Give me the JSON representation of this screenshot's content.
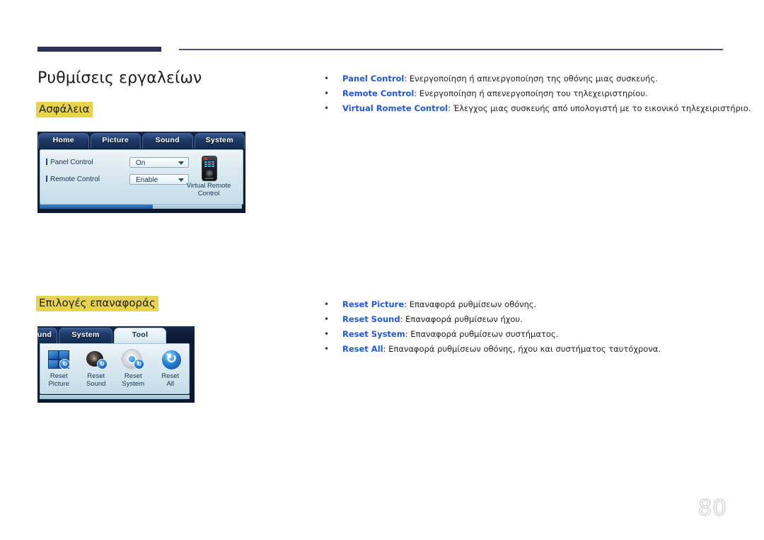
{
  "document": {
    "title": "Ρυθμίσεις εργαλείων",
    "page_number": "80",
    "accent_color": "#2e3156",
    "highlight_color": "#e8d34c",
    "term_color": "#2158d8"
  },
  "sections": [
    {
      "heading": "Ασφάλεια",
      "bullets": [
        {
          "bullet": "•",
          "term": "Panel Control",
          "sep": ": ",
          "desc": "Ενεργοποίηση ή απενεργοποίηση της οθόνης μιας συσκευής."
        },
        {
          "bullet": "•",
          "term": "Remote Control",
          "sep": ": ",
          "desc": "Ενεργοποίηση ή απενεργοποίηση του τηλεχειριστηρίου."
        },
        {
          "bullet": "•",
          "term": "Virtual Romete Control",
          "sep": ": ",
          "desc": "Έλεγχος μιας συσκευής από υπολογιστή με το εικονικό τηλεχειριστήριο."
        }
      ]
    },
    {
      "heading": "Επιλογές επαναφοράς",
      "bullets": [
        {
          "bullet": "•",
          "term": "Reset Picture",
          "sep": ": ",
          "desc": "Επαναφορά ρυθμίσεων οθόνης."
        },
        {
          "bullet": "•",
          "term": "Reset Sound",
          "sep": ": ",
          "desc": "Επαναφορά ρυθμίσεων ήχου."
        },
        {
          "bullet": "•",
          "term": "Reset System",
          "sep": ": ",
          "desc": "Επαναφορά ρυθμίσεων συστήματος."
        },
        {
          "bullet": "•",
          "term": "Reset All",
          "sep": ": ",
          "desc": "Επαναφορά ρυθμίσεων οθόνης, ήχου και συστήματος ταυτόχρονα."
        }
      ]
    }
  ],
  "osd_security": {
    "tabs": [
      {
        "label": "Home",
        "active": false
      },
      {
        "label": "Picture",
        "active": false
      },
      {
        "label": "Sound",
        "active": false
      },
      {
        "label": "System",
        "active": true
      }
    ],
    "rows": [
      {
        "label": "Panel Control",
        "value": "On"
      },
      {
        "label": "Remote Control",
        "value": "Enable"
      }
    ],
    "virtual_remote": {
      "caption_line1": "Virtual Remote",
      "caption_line2": "Control",
      "icon": "remote-control-icon"
    }
  },
  "osd_reset": {
    "tabs": [
      {
        "label": "und",
        "active": false
      },
      {
        "label": "System",
        "active": false
      },
      {
        "label": "Tool",
        "active": true
      }
    ],
    "items": [
      {
        "label_line1": "Reset",
        "label_line2": "Picture",
        "icon": "reset-picture-icon",
        "badge": "↻"
      },
      {
        "label_line1": "Reset",
        "label_line2": "Sound",
        "icon": "reset-sound-icon",
        "badge": "↻"
      },
      {
        "label_line1": "Reset",
        "label_line2": "System",
        "icon": "reset-system-icon",
        "badge": "↻"
      },
      {
        "label_line1": "Reset",
        "label_line2": "All",
        "icon": "reset-all-icon",
        "badge": "↻"
      }
    ]
  }
}
